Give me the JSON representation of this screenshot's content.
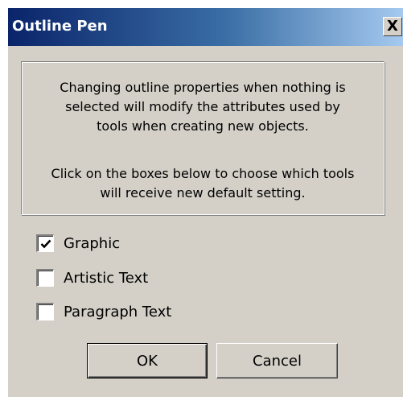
{
  "dialog": {
    "title": "Outline Pen",
    "close_label": "X"
  },
  "info": {
    "paragraph1": [
      "Changing outline properties when nothing is",
      "selected will modify the attributes used by",
      "tools when creating new objects."
    ],
    "paragraph2": [
      "Click on the boxes below to choose which tools",
      "will receive new default setting."
    ]
  },
  "options": [
    {
      "label": "Graphic",
      "checked": true
    },
    {
      "label": "Artistic Text",
      "checked": false
    },
    {
      "label": "Paragraph Text",
      "checked": false
    }
  ],
  "buttons": {
    "ok": "OK",
    "cancel": "Cancel"
  },
  "colors": {
    "titlebar_start": "#0a246a",
    "titlebar_end": "#a6caf0",
    "face": "#d4d0c8"
  }
}
